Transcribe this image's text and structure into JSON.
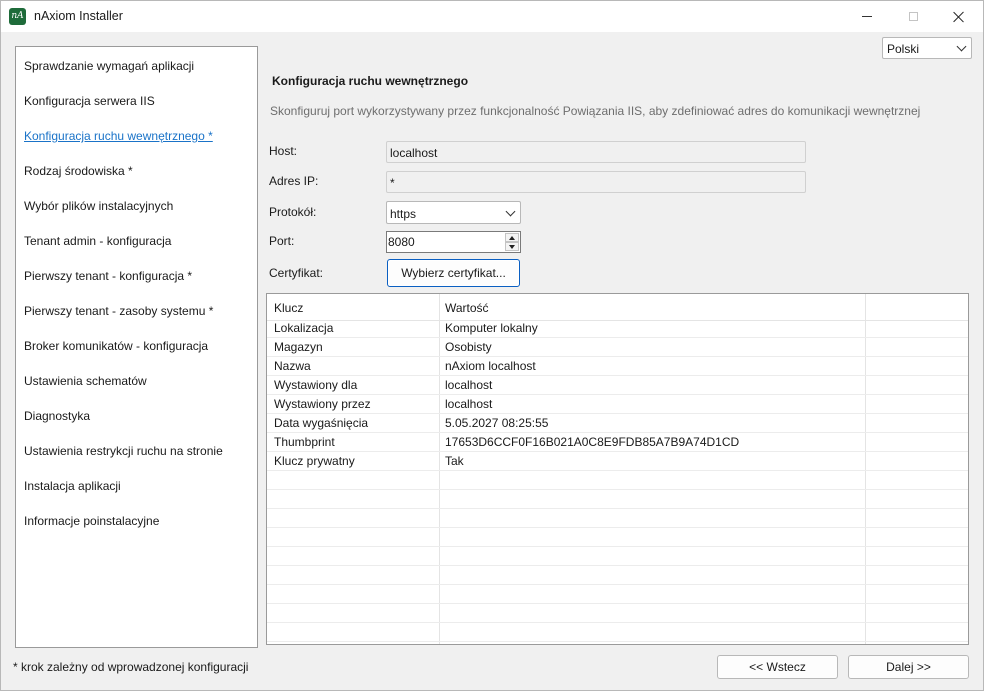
{
  "window": {
    "title": "nAxiom Installer",
    "icon_text": "nA",
    "accent_color": "#1e6b3a"
  },
  "language": {
    "selected": "Polski"
  },
  "steps": [
    {
      "label": "Sprawdzanie wymagań aplikacji",
      "active": false
    },
    {
      "label": "Konfiguracja serwera IIS",
      "active": false
    },
    {
      "label": "Konfiguracja ruchu wewnętrznego *",
      "active": true
    },
    {
      "label": "Rodzaj środowiska *",
      "active": false
    },
    {
      "label": "Wybór plików instalacyjnych",
      "active": false
    },
    {
      "label": "Tenant admin - konfiguracja",
      "active": false
    },
    {
      "label": "Pierwszy tenant - konfiguracja *",
      "active": false
    },
    {
      "label": "Pierwszy tenant - zasoby systemu *",
      "active": false
    },
    {
      "label": "Broker komunikatów - konfiguracja",
      "active": false
    },
    {
      "label": "Ustawienia schematów",
      "active": false
    },
    {
      "label": "Diagnostyka",
      "active": false
    },
    {
      "label": "Ustawienia restrykcji ruchu na stronie",
      "active": false
    },
    {
      "label": "Instalacja aplikacji",
      "active": false
    },
    {
      "label": "Informacje poinstalacyjne",
      "active": false
    }
  ],
  "footnote": "* krok zależny od wprowadzonej konfiguracji",
  "section": {
    "title": "Konfiguracja ruchu wewnętrznego",
    "description": "Skonfiguruj port wykorzystywany przez funkcjonalność Powiązania IIS, aby zdefiniować adres do komunikacji wewnętrznej"
  },
  "form": {
    "host_label": "Host:",
    "host_value": "localhost",
    "ip_label": "Adres IP:",
    "ip_value": "*",
    "protocol_label": "Protokół:",
    "protocol_value": "https",
    "port_label": "Port:",
    "port_value": "8080",
    "cert_label": "Certyfikat:",
    "cert_button": "Wybierz certyfikat..."
  },
  "cert_table": {
    "headers": [
      "Klucz",
      "Wartość"
    ],
    "rows": [
      [
        "Lokalizacja",
        "Komputer lokalny"
      ],
      [
        "Magazyn",
        "Osobisty"
      ],
      [
        "Nazwa",
        "nAxiom localhost"
      ],
      [
        "Wystawiony dla",
        "localhost"
      ],
      [
        "Wystawiony przez",
        "localhost"
      ],
      [
        "Data wygaśnięcia",
        "5.05.2027 08:25:55"
      ],
      [
        "Thumbprint",
        "17653D6CCF0F16B021A0C8E9FDB85A7B9A74D1CD"
      ],
      [
        "Klucz prywatny",
        "Tak"
      ]
    ]
  },
  "nav": {
    "back": "<< Wstecz",
    "next": "Dalej >>"
  }
}
